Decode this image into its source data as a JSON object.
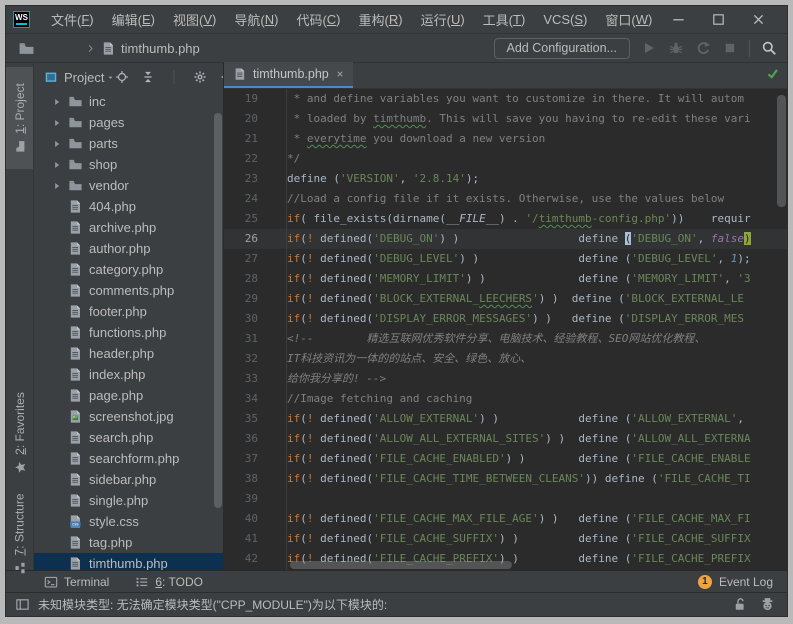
{
  "colors": {
    "accent_blue": "#4a88c7",
    "selection_blue": "#0d2f50",
    "badge_orange": "#f0a441",
    "keyword": "#cc7832",
    "string": "#6a8759",
    "number": "#6897bb",
    "constant": "#9876aa",
    "comment": "#808080",
    "plain_text": "#a9b7c6",
    "editor_bg": "#2b2b2b",
    "panel_bg": "#3c3f41"
  },
  "titlebar": {
    "logo": "WS",
    "menus": [
      {
        "label": "文件",
        "mnemonic": "F"
      },
      {
        "label": "编辑",
        "mnemonic": "E"
      },
      {
        "label": "视图",
        "mnemonic": "V"
      },
      {
        "label": "导航",
        "mnemonic": "N"
      },
      {
        "label": "代码",
        "mnemonic": "C"
      },
      {
        "label": "重构",
        "mnemonic": "R"
      },
      {
        "label": "运行",
        "mnemonic": "U"
      },
      {
        "label": "工具",
        "mnemonic": "T"
      },
      {
        "label": "VCS",
        "mnemonic": "S"
      },
      {
        "label": "窗口",
        "mnemonic": "W"
      }
    ],
    "window_controls": [
      "minimize",
      "maximize",
      "close"
    ]
  },
  "toolbar": {
    "nav_file": "timthumb.php",
    "run_config_label": "Add Configuration...",
    "actions": [
      "run",
      "debug",
      "rerun",
      "stop"
    ],
    "search": "search"
  },
  "stripe": {
    "top": [
      {
        "num": "1",
        "label": "Project",
        "icon": "stripe-folder",
        "active": true
      }
    ],
    "bottom": [
      {
        "num": "2",
        "label": "Favorites",
        "icon": "star",
        "active": false
      },
      {
        "num": "7",
        "label": "Structure",
        "icon": "structure",
        "active": false
      }
    ]
  },
  "project_panel": {
    "title": "Project",
    "actions": [
      "locate",
      "collapse-all",
      "separator",
      "settings",
      "hide"
    ],
    "tree": [
      {
        "name": "inc",
        "type": "folder"
      },
      {
        "name": "pages",
        "type": "folder"
      },
      {
        "name": "parts",
        "type": "folder"
      },
      {
        "name": "shop",
        "type": "folder"
      },
      {
        "name": "vendor",
        "type": "folder"
      },
      {
        "name": "404.php",
        "type": "php"
      },
      {
        "name": "archive.php",
        "type": "php"
      },
      {
        "name": "author.php",
        "type": "php"
      },
      {
        "name": "category.php",
        "type": "php"
      },
      {
        "name": "comments.php",
        "type": "php"
      },
      {
        "name": "footer.php",
        "type": "php"
      },
      {
        "name": "functions.php",
        "type": "php"
      },
      {
        "name": "header.php",
        "type": "php"
      },
      {
        "name": "index.php",
        "type": "php"
      },
      {
        "name": "page.php",
        "type": "php"
      },
      {
        "name": "screenshot.jpg",
        "type": "img"
      },
      {
        "name": "search.php",
        "type": "php"
      },
      {
        "name": "searchform.php",
        "type": "php"
      },
      {
        "name": "sidebar.php",
        "type": "php"
      },
      {
        "name": "single.php",
        "type": "php"
      },
      {
        "name": "style.css",
        "type": "css"
      },
      {
        "name": "tag.php",
        "type": "php"
      },
      {
        "name": "timthumb.php",
        "type": "php",
        "selected": true
      }
    ]
  },
  "editor": {
    "tab_label": "timthumb.php",
    "lines": [
      {
        "n": "19",
        "tk": [
          [
            "cmt",
            " * and define variables you want to customize in there. It will autom"
          ]
        ]
      },
      {
        "n": "20",
        "tk": [
          [
            "cmt",
            " * loaded by "
          ],
          [
            "cmt typo",
            "timthumb"
          ],
          [
            "cmt",
            ". This will save you having to re-edit these vari"
          ]
        ]
      },
      {
        "n": "21",
        "tk": [
          [
            "cmt",
            " * "
          ],
          [
            "cmt typo",
            "everytime"
          ],
          [
            "cmt",
            " you download a new version"
          ]
        ]
      },
      {
        "n": "22",
        "tk": [
          [
            "cmt",
            "*/"
          ]
        ]
      },
      {
        "n": "23",
        "tk": [
          [
            "pln",
            "define ("
          ],
          [
            "str",
            "'VERSION'"
          ],
          [
            "pln",
            ", "
          ],
          [
            "str",
            "'2.8.14'"
          ],
          [
            "pln",
            ");"
          ]
        ]
      },
      {
        "n": "24",
        "tk": [
          [
            "cmt",
            "//Load a config file if it exists. Otherwise, use the values below"
          ]
        ]
      },
      {
        "n": "25",
        "tk": [
          [
            "kw",
            "if"
          ],
          [
            "pln",
            "( file_exists(dirname("
          ],
          [
            "mag",
            "__FILE__"
          ],
          [
            "pln",
            ") . "
          ],
          [
            "str",
            "'/"
          ],
          [
            "str typo",
            "timthumb"
          ],
          [
            "str",
            "-config.php'"
          ],
          [
            "pln",
            "))    requir"
          ]
        ]
      },
      {
        "n": "26",
        "cur": true,
        "tk": [
          [
            "kw",
            "if"
          ],
          [
            "pln",
            "("
          ],
          [
            "kw",
            "!"
          ],
          [
            "pln",
            " defined("
          ],
          [
            "str",
            "'DEBUG_ON'"
          ],
          [
            "pln",
            ") )                  define "
          ],
          [
            "brL",
            "("
          ],
          [
            "str",
            "'DEBUG_ON'"
          ],
          [
            "pln",
            ", "
          ],
          [
            "cnst",
            "false"
          ],
          [
            "brR",
            ")"
          ]
        ]
      },
      {
        "n": "27",
        "tk": [
          [
            "kw",
            "if"
          ],
          [
            "pln",
            "("
          ],
          [
            "kw",
            "!"
          ],
          [
            "pln",
            " defined("
          ],
          [
            "str",
            "'DEBUG_LEVEL'"
          ],
          [
            "pln",
            ") )               define ("
          ],
          [
            "str",
            "'DEBUG_LEVEL'"
          ],
          [
            "pln",
            ", "
          ],
          [
            "num",
            "1"
          ],
          [
            "pln",
            ");"
          ]
        ]
      },
      {
        "n": "28",
        "tk": [
          [
            "kw",
            "if"
          ],
          [
            "pln",
            "("
          ],
          [
            "kw",
            "!"
          ],
          [
            "pln",
            " defined("
          ],
          [
            "str",
            "'MEMORY_LIMIT'"
          ],
          [
            "pln",
            ") )              define ("
          ],
          [
            "str",
            "'MEMORY_LIMIT'"
          ],
          [
            "pln",
            ", "
          ],
          [
            "str",
            "'3"
          ]
        ]
      },
      {
        "n": "29",
        "tk": [
          [
            "kw",
            "if"
          ],
          [
            "pln",
            "("
          ],
          [
            "kw",
            "!"
          ],
          [
            "pln",
            " defined("
          ],
          [
            "str",
            "'BLOCK_EXTERNAL_"
          ],
          [
            "str typo",
            "LEECHERS"
          ],
          [
            "str",
            "'"
          ],
          [
            "pln",
            ") )  define ("
          ],
          [
            "str",
            "'BLOCK_EXTERNAL_LE"
          ]
        ]
      },
      {
        "n": "30",
        "tk": [
          [
            "kw",
            "if"
          ],
          [
            "pln",
            "("
          ],
          [
            "kw",
            "!"
          ],
          [
            "pln",
            " defined("
          ],
          [
            "str",
            "'DISPLAY_ERROR_MESSAGES'"
          ],
          [
            "pln",
            ") )   define ("
          ],
          [
            "str",
            "'DISPLAY_ERROR_MES"
          ]
        ]
      },
      {
        "n": "31",
        "tk": [
          [
            "cmtI",
            "<!--        精选互联网优秀软件分享、电脑技术、经验教程、SEO网站优化教程、"
          ]
        ]
      },
      {
        "n": "32",
        "tk": [
          [
            "cmtI",
            "IT科技资讯为一体的的站点、安全、绿色、放心、"
          ]
        ]
      },
      {
        "n": "33",
        "tk": [
          [
            "cmtI",
            "给你我分享的! -->"
          ]
        ]
      },
      {
        "n": "34",
        "tk": [
          [
            "cmt",
            "//Image fetching and caching"
          ]
        ]
      },
      {
        "n": "35",
        "tk": [
          [
            "kw",
            "if"
          ],
          [
            "pln",
            "("
          ],
          [
            "kw",
            "!"
          ],
          [
            "pln",
            " defined("
          ],
          [
            "str",
            "'ALLOW_EXTERNAL'"
          ],
          [
            "pln",
            ") )            define ("
          ],
          [
            "str",
            "'ALLOW_EXTERNAL'"
          ],
          [
            "pln",
            ","
          ]
        ]
      },
      {
        "n": "36",
        "tk": [
          [
            "kw",
            "if"
          ],
          [
            "pln",
            "("
          ],
          [
            "kw",
            "!"
          ],
          [
            "pln",
            " defined("
          ],
          [
            "str",
            "'ALLOW_ALL_EXTERNAL_SITES'"
          ],
          [
            "pln",
            ") )  define ("
          ],
          [
            "str",
            "'ALLOW_ALL_EXTERNA"
          ]
        ]
      },
      {
        "n": "37",
        "tk": [
          [
            "kw",
            "if"
          ],
          [
            "pln",
            "("
          ],
          [
            "kw",
            "!"
          ],
          [
            "pln",
            " defined("
          ],
          [
            "str",
            "'FILE_CACHE_ENABLED'"
          ],
          [
            "pln",
            ") )        define ("
          ],
          [
            "str",
            "'FILE_CACHE_ENABLE"
          ]
        ]
      },
      {
        "n": "38",
        "tk": [
          [
            "kw",
            "if"
          ],
          [
            "pln",
            "("
          ],
          [
            "kw",
            "!"
          ],
          [
            "pln",
            " defined("
          ],
          [
            "str",
            "'FILE_CACHE_TIME_BETWEEN_CLEANS'"
          ],
          [
            "pln",
            ")) define ("
          ],
          [
            "str",
            "'FILE_CACHE_TI"
          ]
        ]
      },
      {
        "n": "39",
        "tk": []
      },
      {
        "n": "40",
        "tk": [
          [
            "kw",
            "if"
          ],
          [
            "pln",
            "("
          ],
          [
            "kw",
            "!"
          ],
          [
            "pln",
            " defined("
          ],
          [
            "str",
            "'FILE_CACHE_MAX_FILE_AGE'"
          ],
          [
            "pln",
            ") )   define ("
          ],
          [
            "str",
            "'FILE_CACHE_MAX_FI"
          ]
        ]
      },
      {
        "n": "41",
        "tk": [
          [
            "kw",
            "if"
          ],
          [
            "pln",
            "("
          ],
          [
            "kw",
            "!"
          ],
          [
            "pln",
            " defined("
          ],
          [
            "str",
            "'FILE_CACHE_SUFFIX'"
          ],
          [
            "pln",
            ") )         define ("
          ],
          [
            "str",
            "'FILE_CACHE_SUFFIX"
          ]
        ]
      },
      {
        "n": "42",
        "tk": [
          [
            "kw",
            "if"
          ],
          [
            "pln",
            "("
          ],
          [
            "kw",
            "!"
          ],
          [
            "pln",
            " defined("
          ],
          [
            "str",
            "'FILE_CACHE_PREFIX'"
          ],
          [
            "pln",
            ") )         define ("
          ],
          [
            "str",
            "'FILE_CACHE_PREFIX"
          ]
        ]
      }
    ]
  },
  "bottom_bar": {
    "left": [
      {
        "icon": "terminal",
        "label": "Terminal"
      },
      {
        "icon": "todo",
        "num": "6",
        "label": "TODO"
      }
    ],
    "event_badge": "1",
    "event_log_label": "Event Log"
  },
  "status_bar": {
    "message": "未知模块类型: 无法确定模块类型(\"CPP_MODULE\")为以下模块的:",
    "right_icons": [
      "lock-open",
      "hector"
    ]
  }
}
